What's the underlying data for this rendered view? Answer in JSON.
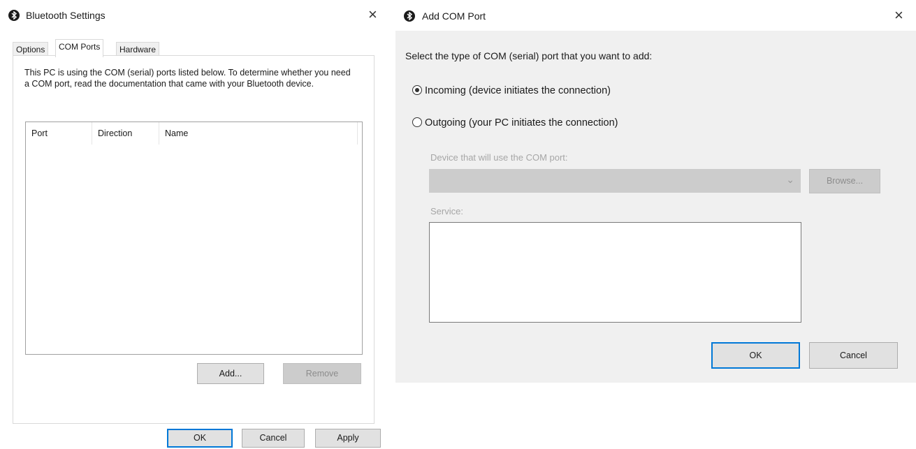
{
  "bt_settings": {
    "title": "Bluetooth Settings",
    "close": "×",
    "tabs": [
      {
        "label": "Options"
      },
      {
        "label": "COM Ports"
      },
      {
        "label": "Hardware"
      }
    ],
    "intro_text": "This PC is using the COM (serial) ports listed below. To determine whether you need a COM port, read the documentation that came with your Bluetooth device.",
    "columns": [
      "Port",
      "Direction",
      "Name"
    ],
    "add_label": "Add...",
    "remove_label": "Remove",
    "ok_label": "OK",
    "cancel_label": "Cancel",
    "apply_label": "Apply"
  },
  "add_com": {
    "title": "Add COM Port",
    "close": "×",
    "prompt": "Select the type of COM (serial) port that you want to add:",
    "incoming_label": "Incoming (device initiates the connection)",
    "outgoing_label": "Outgoing (your PC initiates the connection)",
    "selected": "incoming",
    "device_label": "Device that will use the COM port:",
    "device_value": "",
    "browse_label": "Browse...",
    "service_label": "Service:",
    "ok_label": "OK",
    "cancel_label": "Cancel"
  },
  "icons": {
    "app": "bluetooth-icon"
  },
  "colors": {
    "focus": "#0078d7",
    "disabled_bg": "#cccccc",
    "dialog_bg": "#f0f0f0"
  }
}
